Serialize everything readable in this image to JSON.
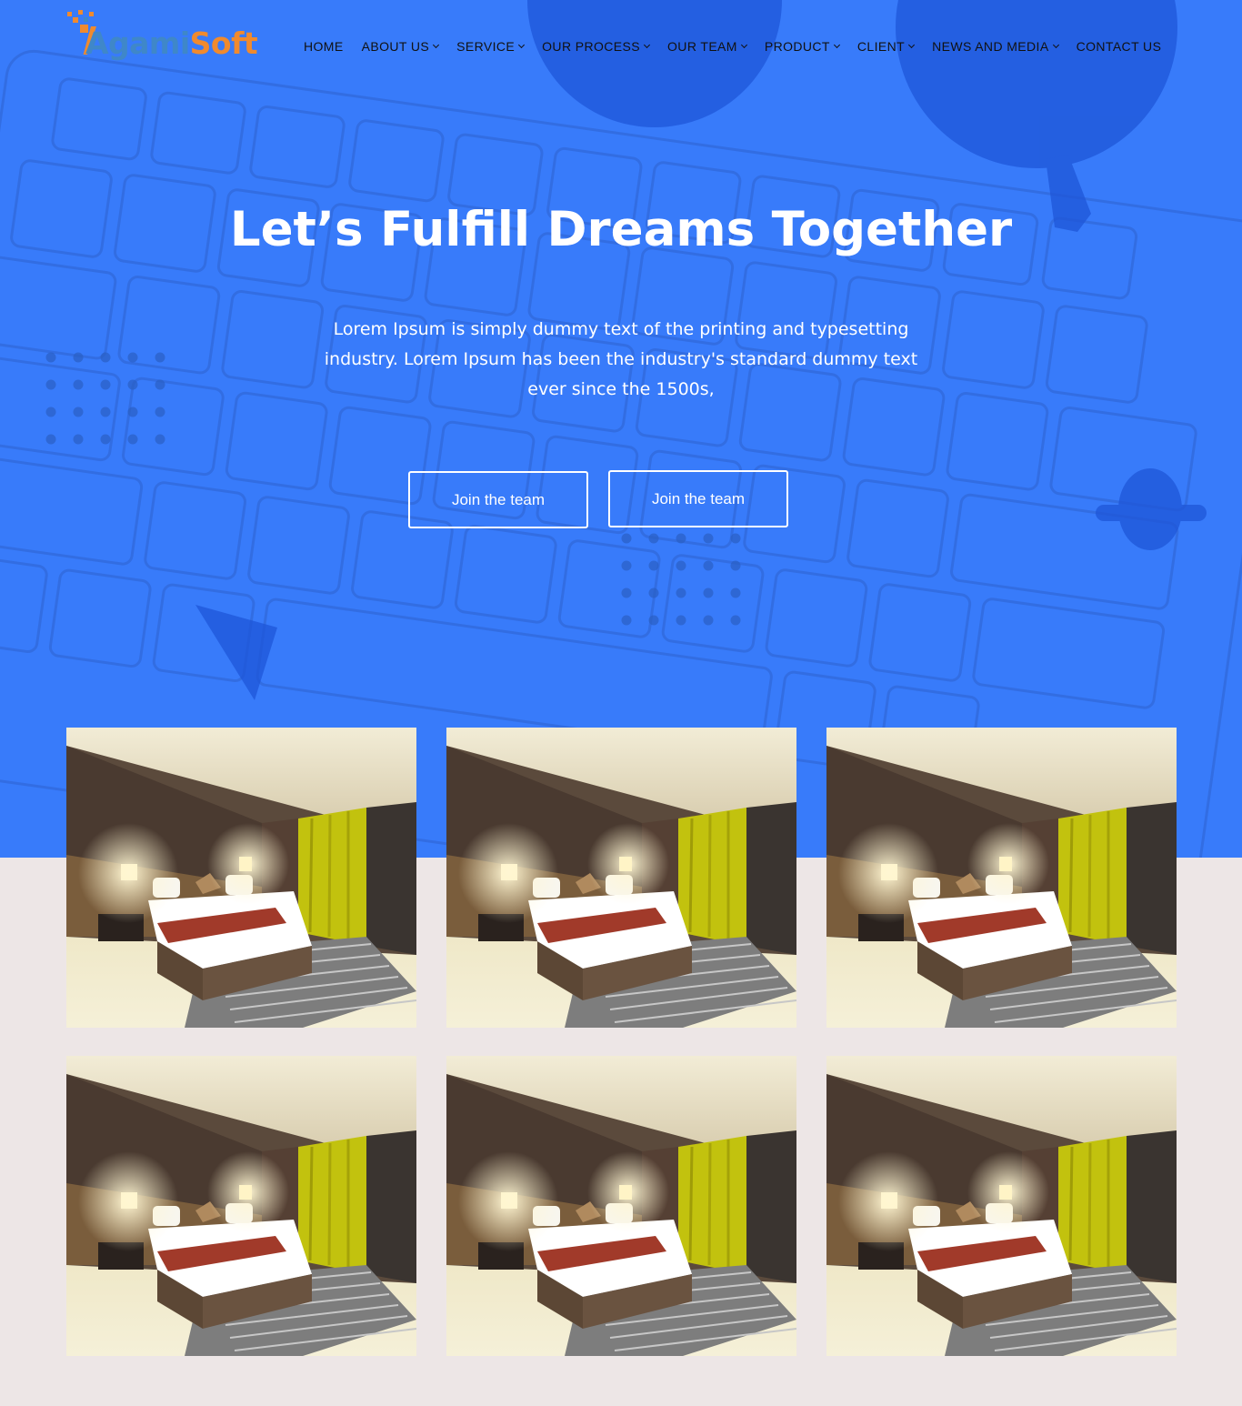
{
  "brand": {
    "logo_part1": "Agami",
    "logo_part2": "Soft"
  },
  "nav": {
    "items": [
      {
        "label": "HOME",
        "dropdown": false
      },
      {
        "label": "ABOUT US",
        "dropdown": true
      },
      {
        "label": "SERVICE",
        "dropdown": true
      },
      {
        "label": "OUR PROCESS",
        "dropdown": true
      },
      {
        "label": "OUR TEAM",
        "dropdown": true
      },
      {
        "label": "PRODUCT",
        "dropdown": true
      },
      {
        "label": "CLIENT",
        "dropdown": true
      },
      {
        "label": "NEWS AND MEDIA",
        "dropdown": true
      },
      {
        "label": "CONTACT US",
        "dropdown": false
      }
    ]
  },
  "hero": {
    "title": "Let’s Fulfill Dreams Together",
    "text": "Lorem Ipsum is simply dummy text of the printing and typesetting industry. Lorem Ipsum has been the industry's standard dummy text ever since the 1500s,",
    "button1": "Join the team",
    "button2": "Join the team"
  },
  "colors": {
    "hero_bg": "#387bfa",
    "page_bg": "#ede6e6",
    "logo_blue": "#3f87c9",
    "logo_orange": "#f08a2e"
  },
  "gallery": {
    "count": 6,
    "image_subject": "hotel-bedroom-photo"
  }
}
